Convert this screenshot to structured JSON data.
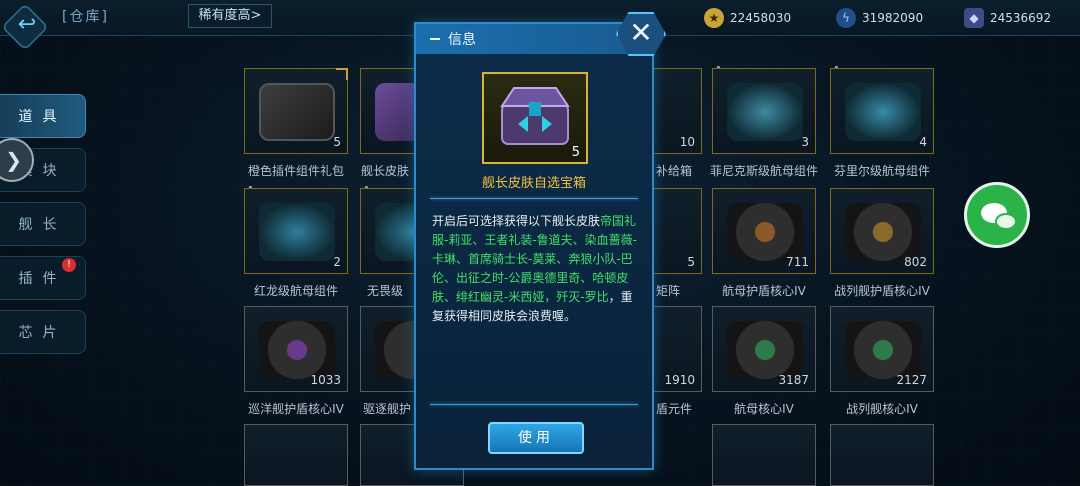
{
  "topbar": {
    "title": "[仓库]",
    "sort_label": "稀有度高>",
    "resources": [
      {
        "icon": "coin-icon",
        "value": "22458030"
      },
      {
        "icon": "lightning-icon",
        "value": "31982090"
      },
      {
        "icon": "crystal-icon",
        "value": "24536692"
      }
    ]
  },
  "nav": {
    "items": [
      {
        "label": "道具",
        "active": true
      },
      {
        "label": "模块",
        "active": false
      },
      {
        "label": "舰长",
        "active": false
      },
      {
        "label": "插件",
        "active": false
      },
      {
        "label": "芯片",
        "active": false
      }
    ],
    "badge": "!"
  },
  "grid": {
    "row1": [
      {
        "name": "橙色插件组件礼包",
        "count": "5"
      },
      {
        "name": "舰长皮肤",
        "count": ""
      },
      {
        "name": "补给箱",
        "count": "10"
      },
      {
        "name": "菲尼克斯级航母组件",
        "count": "3"
      },
      {
        "name": "芬里尔级航母组件",
        "count": "4"
      }
    ],
    "row2": [
      {
        "name": "红龙级航母组件",
        "count": "2"
      },
      {
        "name": "无畏级",
        "count": ""
      },
      {
        "name": "矩阵",
        "count": "5"
      },
      {
        "name": "航母护盾核心IV",
        "count": "711"
      },
      {
        "name": "战列舰护盾核心IV",
        "count": "802"
      }
    ],
    "row3": [
      {
        "name": "巡洋舰护盾核心IV",
        "count": "1033"
      },
      {
        "name": "驱逐舰护",
        "count": ""
      },
      {
        "name": "盾元件",
        "count": "1910"
      },
      {
        "name": "航母核心IV",
        "count": "3187"
      },
      {
        "name": "战列舰核心IV",
        "count": "2127"
      }
    ]
  },
  "modal": {
    "title": "信息",
    "item_name": "舰长皮肤自选宝箱",
    "item_count": "5",
    "desc_prefix": "开启后可选择获得以下舰长皮肤",
    "desc_highlight": "帝国礼服-莉亚、王者礼装-鲁道夫、染血蔷薇-卡琳、首席骑士长-莫莱、奔狼小队-巴伦、出征之时-公爵奥德里奇、哈顿皮肤、绯红幽灵-米西娅，歼灭-罗比",
    "desc_suffix": "，重复获得相同皮肤会浪费喔。",
    "use_label": "使用"
  }
}
